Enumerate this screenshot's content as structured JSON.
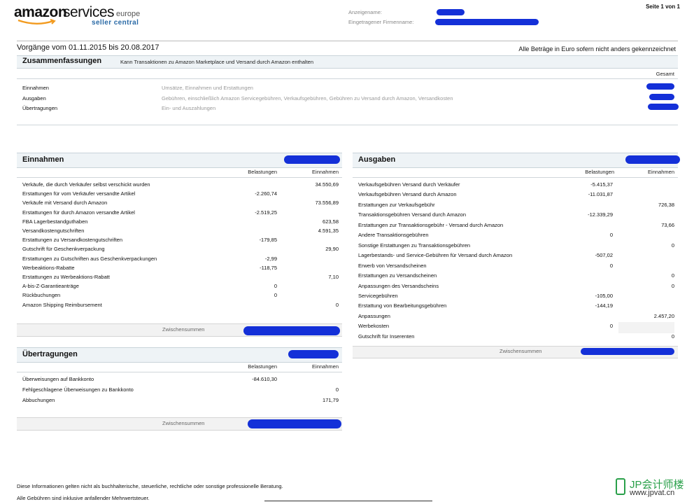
{
  "header": {
    "logo_amazon": "amazon",
    "logo_services": "services",
    "logo_europe": "europe",
    "logo_seller_central": "seller central",
    "display_name_label": "Anzeigename:",
    "company_name_label": "Eingetragener Firmenname:",
    "page_number": "Seite 1 von 1"
  },
  "period": "Vorgänge vom 01.11.2015 bis 20.08.2017",
  "currency_note": "Alle Beträge in Euro sofern nicht anders gekennzeichnet",
  "summary": {
    "title": "Zusammenfassungen",
    "subtitle": "Kann Transaktionen zu Amazon Marketplace und Versand durch Amazon enthalten",
    "total_header": "Gesamt",
    "rows": [
      {
        "label": "Einnahmen",
        "desc": "Umsätze, Einnahmen und Erstattungen"
      },
      {
        "label": "Ausgaben",
        "desc": "Gebühren, einschließlich Amazon Servicegebühren, Verkaufsgebühren, Gebühren zu Versand durch Amazon, Versandkosten"
      },
      {
        "label": "Übertragungen",
        "desc": "Ein- und Auszahlungen"
      }
    ]
  },
  "income": {
    "title": "Einnahmen",
    "col_debits": "Belastungen",
    "col_credits": "Einnahmen",
    "rows": [
      {
        "label": "Verkäufe, die durch Verkäufer selbst verschickt wurden",
        "debit": "",
        "credit": "34.550,69"
      },
      {
        "label": "Erstattungen für vom Verkäufer versandte Artikel",
        "debit": "-2.260,74",
        "credit": ""
      },
      {
        "label": "Verkäufe mit Versand durch Amazon",
        "debit": "",
        "credit": "73.556,89"
      },
      {
        "label": "Erstattungen für durch Amazon versandte Artikel",
        "debit": "-2.519,25",
        "credit": ""
      },
      {
        "label": "FBA Lagerbestandguthaben",
        "debit": "",
        "credit": "623,58"
      },
      {
        "label": "Versandkostengutschriften",
        "debit": "",
        "credit": "4.591,35"
      },
      {
        "label": "Erstattungen zu Versandkostengutschriften",
        "debit": "-179,85",
        "credit": ""
      },
      {
        "label": "Gutschrift für Geschenkverpackung",
        "debit": "",
        "credit": "29,90"
      },
      {
        "label": "Erstattungen zu Gutschriften aus Geschenkverpackungen",
        "debit": "-2,99",
        "credit": ""
      },
      {
        "label": "Werbeaktions-Rabatte",
        "debit": "-118,75",
        "credit": ""
      },
      {
        "label": "Erstattungen zu Werbeaktions-Rabatt",
        "debit": "",
        "credit": "7,10"
      },
      {
        "label": "A-bis-Z-Garantieanträge",
        "debit": "0",
        "credit": ""
      },
      {
        "label": "Rückbuchungen",
        "debit": "0",
        "credit": ""
      },
      {
        "label": "Amazon Shipping Reimbursement",
        "debit": "",
        "credit": "0"
      }
    ],
    "subtotal_label": "Zwischensummen"
  },
  "transfers": {
    "title": "Übertragungen",
    "col_debits": "Belastungen",
    "col_credits": "Einnahmen",
    "rows": [
      {
        "label": "Überweisungen auf Bankkonto",
        "debit": "-84.610,30",
        "credit": ""
      },
      {
        "label": "Fehlgeschlagene Überweisungen zu Bankkonto",
        "debit": "",
        "credit": "0"
      },
      {
        "label": "Abbuchungen",
        "debit": "",
        "credit": "171,79"
      }
    ],
    "subtotal_label": "Zwischensummen"
  },
  "expenses": {
    "title": "Ausgaben",
    "col_debits": "Belastungen",
    "col_credits": "Einnahmen",
    "rows": [
      {
        "label": "Verkaufsgebühren Versand durch Verkäufer",
        "debit": "-5.415,37",
        "credit": ""
      },
      {
        "label": "Verkaufsgebühren Versand durch Amazon",
        "debit": "-11.031,87",
        "credit": ""
      },
      {
        "label": "Erstattungen zur Verkaufsgebühr",
        "debit": "",
        "credit": "726,38"
      },
      {
        "label": "Transaktionsgebühren Versand durch Amazon",
        "debit": "-12.339,29",
        "credit": ""
      },
      {
        "label": "Erstattungen zur Transaktionsgebühr - Versand durch Amazon",
        "debit": "",
        "credit": "73,66"
      },
      {
        "label": "Andere Transaktionsgebühren",
        "debit": "0",
        "credit": ""
      },
      {
        "label": "Sonstige Erstattungen zu Transaktionsgebühren",
        "debit": "",
        "credit": "0"
      },
      {
        "label": "Lagerbestands- und Service-Gebühren für Versand durch Amazon",
        "debit": "-507,02",
        "credit": ""
      },
      {
        "label": "Erwerb von Versandscheinen",
        "debit": "0",
        "credit": ""
      },
      {
        "label": "Erstattungen zu Versandscheinen",
        "debit": "",
        "credit": "0"
      },
      {
        "label": "Anpassungen des Versandscheins",
        "debit": "",
        "credit": "0"
      },
      {
        "label": "Servicegebühren",
        "debit": "-105,00",
        "credit": ""
      },
      {
        "label": "Erstattung von Bearbeitungsgebühren",
        "debit": "-144,19",
        "credit": ""
      },
      {
        "label": "Anpassungen",
        "debit": "",
        "credit": "2.457,20"
      },
      {
        "label": "Werbekosten",
        "debit": "0",
        "credit": ""
      },
      {
        "label": "Gutschrift für Inserenten",
        "debit": "",
        "credit": "0"
      }
    ],
    "subtotal_label": "Zwischensummen"
  },
  "footer": {
    "line1": "Diese Informationen gelten nicht als buchhalterische, steuerliche, rechtliche oder sonstige professionelle Beratung.",
    "line2": "Alle Gebühren sind inklusive anfallender Mehrwertsteuer."
  },
  "watermark": {
    "brand": "JP会计师楼",
    "url": "www.jpvat.cn"
  },
  "colors": {
    "redaction": "#1430d8",
    "section_bar": "#eef3f6",
    "seller_central": "#2a6aa6",
    "watermark_green": "#2aa04a"
  }
}
